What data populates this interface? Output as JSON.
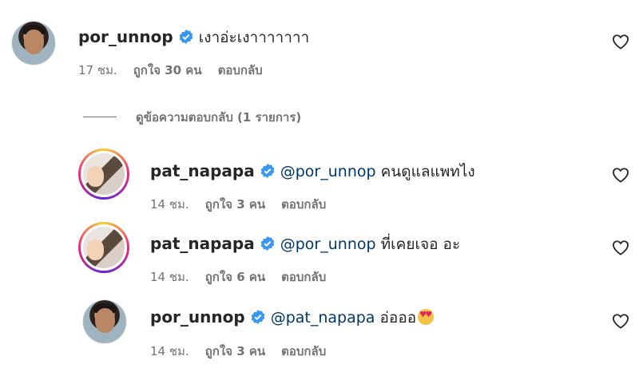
{
  "comment": {
    "username": "por_unnop",
    "text": "เงาอ่ะเงาาาาาาา",
    "time": "17 ชม.",
    "likes": "ถูกใจ 30 คน",
    "reply_label": "ตอบกลับ"
  },
  "view_replies_label": "ดูข้อความตอบกลับ (1 รายการ)",
  "replies": [
    {
      "username": "pat_napapa",
      "mention": "@por_unnop",
      "text": "คนดูแลแพทไง",
      "time": "14 ชม.",
      "likes": "ถูกใจ 3 คน",
      "reply_label": "ตอบกลับ"
    },
    {
      "username": "pat_napapa",
      "mention": "@por_unnop",
      "text": "ที่เคยเจอ อะ",
      "time": "14 ชม.",
      "likes": "ถูกใจ 6 คน",
      "reply_label": "ตอบกลับ"
    },
    {
      "username": "por_unnop",
      "mention": "@pat_napapa",
      "text": "อ่อออ",
      "emoji": "heart-eyes-emoji",
      "time": "14 ชม.",
      "likes": "ถูกใจ 3 คน",
      "reply_label": "ตอบกลับ"
    }
  ],
  "colors": {
    "verified": "#3897f0",
    "mention": "#00376b",
    "meta": "#737373",
    "text": "#262626"
  }
}
